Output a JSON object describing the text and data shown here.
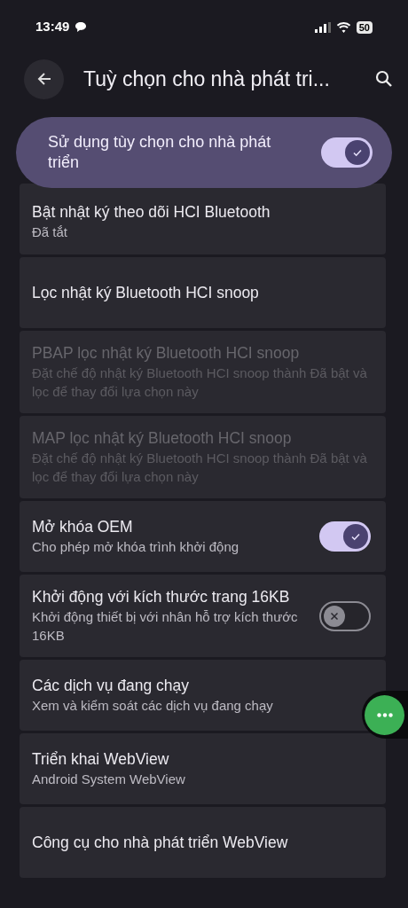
{
  "status_bar": {
    "time": "13:49",
    "battery": "50"
  },
  "app_bar": {
    "title": "Tuỳ chọn cho nhà phát tri..."
  },
  "master_switch": {
    "label": "Sử dụng tùy chọn cho nhà phát triển",
    "on": true
  },
  "settings": [
    {
      "kind": "text",
      "title": "Bật nhật ký theo dõi HCI Bluetooth",
      "summary": "Đã tắt",
      "disabled": false
    },
    {
      "kind": "text",
      "title": "Lọc nhật ký Bluetooth HCI snoop",
      "disabled": false
    },
    {
      "kind": "text",
      "title": "PBAP lọc nhật ký Bluetooth HCI snoop",
      "summary": "Đặt chế độ nhật ký Bluetooth HCI snoop thành Đã bật và lọc để thay đổi lựa chọn này",
      "disabled": true
    },
    {
      "kind": "text",
      "title": "MAP lọc nhật ký Bluetooth HCI snoop",
      "summary": "Đặt chế độ nhật ký Bluetooth HCI snoop thành Đã bật và lọc để thay đổi lựa chọn này",
      "disabled": true
    },
    {
      "kind": "switch",
      "title": "Mở khóa OEM",
      "summary": "Cho phép mở khóa trình khởi động",
      "disabled": false,
      "on": true
    },
    {
      "kind": "switch",
      "title": "Khởi động với kích thước trang 16KB",
      "summary": "Khởi động thiết bị với nhân hỗ trợ kích thước 16KB",
      "disabled": false,
      "on": false
    },
    {
      "kind": "text",
      "title": "Các dịch vụ đang chạy",
      "summary": "Xem và kiểm soát các dịch vụ đang chạy",
      "disabled": false
    },
    {
      "kind": "text",
      "title": "Triển khai WebView",
      "summary": "Android System WebView",
      "disabled": false
    },
    {
      "kind": "text",
      "title": "Công cụ cho nhà phát triển WebView",
      "disabled": false
    }
  ]
}
